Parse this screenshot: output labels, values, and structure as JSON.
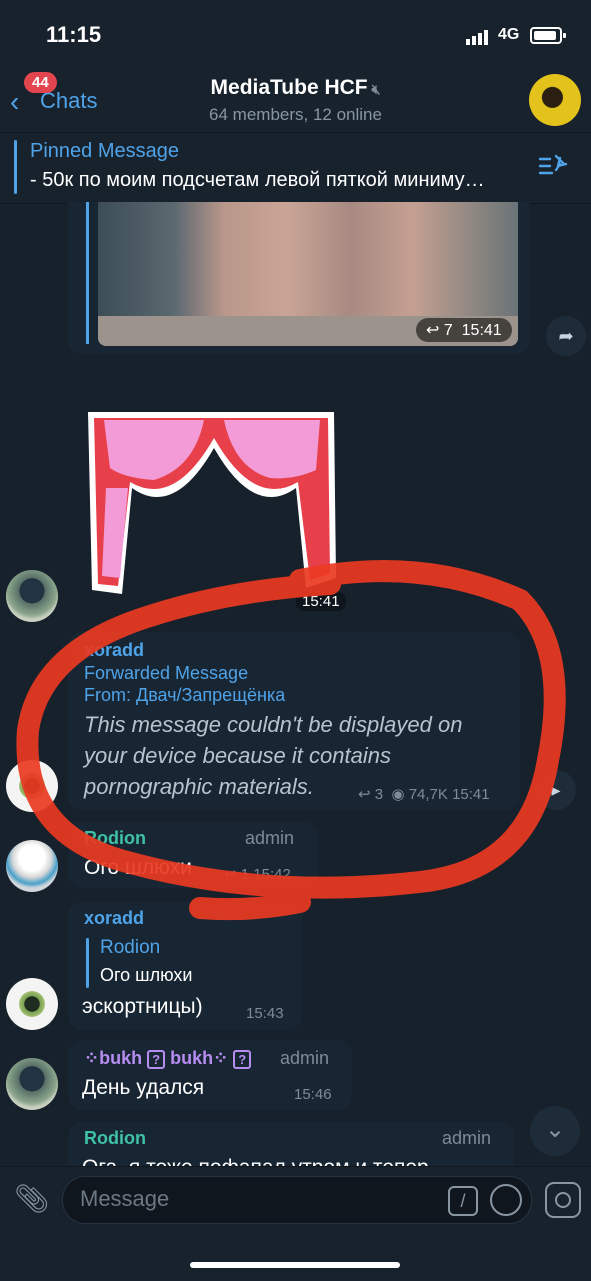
{
  "status": {
    "time": "11:15",
    "network": "4G"
  },
  "header": {
    "back_label": "Chats",
    "unread_badge": "44",
    "title": "MediaTube HCF",
    "subtitle": "64 members, 12 online"
  },
  "pinned": {
    "title": "Pinned Message",
    "text": "- 50к по моим подсчетам левой пяткой миниму…"
  },
  "photo_message": {
    "replies": "7",
    "time": "15:41"
  },
  "sticker_message": {
    "time": "15:41"
  },
  "forwarded_message": {
    "sender": "xoradd",
    "forward_label": "Forwarded Message",
    "from_prefix": "From: ",
    "from_source": "Двач/Запрещёнка",
    "text_line1": "This message couldn't be displayed on",
    "text_line2": "your device because it contains",
    "text_line3": "pornographic materials.",
    "replies": "3",
    "views": "74,7K",
    "time": "15:41"
  },
  "rodion_message1": {
    "sender": "Rodion",
    "role": "admin",
    "text": "Ого шлюхи",
    "replies": "1",
    "time": "15:42"
  },
  "xoradd_reply": {
    "sender": "xoradd",
    "quoted_name": "Rodion",
    "quoted_text": "Ого шлюхи",
    "text": "эскортницы)",
    "time": "15:43"
  },
  "bukh_message": {
    "sender": "bukh",
    "sender_repeat": "bukh",
    "role": "admin",
    "text": "День удался",
    "time": "15:46"
  },
  "rodion_message2": {
    "sender": "Rodion",
    "role": "admin",
    "text_partial": "Ога, я тоже пофапал утром и тепер"
  },
  "input": {
    "placeholder": "Message"
  },
  "colors": {
    "accent": "#4fa3e8",
    "badge": "#e3454f",
    "background": "#17212b",
    "scribble": "#ea3a22"
  }
}
